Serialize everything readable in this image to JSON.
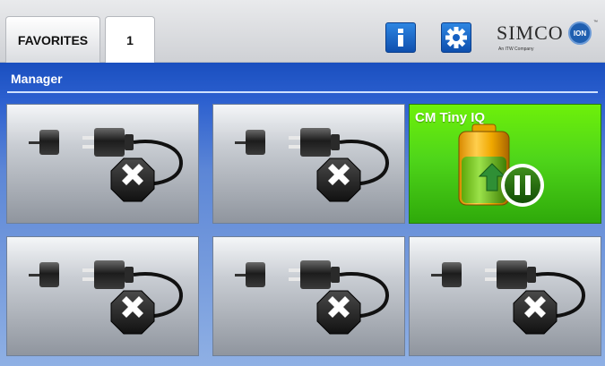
{
  "header": {
    "tabs": [
      {
        "label": "FAVORITES"
      },
      {
        "label": "1"
      }
    ],
    "logo": {
      "brand": "SIMCO",
      "badge": "ION",
      "tagline": "An ITW Company",
      "tm": "™"
    },
    "icons": [
      "info-icon",
      "gear-icon"
    ]
  },
  "manager": {
    "title": "Manager",
    "tiles": [
      {
        "status": "disconnected",
        "label": ""
      },
      {
        "status": "disconnected",
        "label": ""
      },
      {
        "status": "connected",
        "label": "CM Tiny IQ"
      },
      {
        "status": "disconnected",
        "label": ""
      },
      {
        "status": "disconnected",
        "label": ""
      },
      {
        "status": "disconnected",
        "label": ""
      }
    ]
  },
  "colors": {
    "panel": "#1a4fbf",
    "active_tile": "#4fd61a",
    "button": "#1f6fd0"
  }
}
